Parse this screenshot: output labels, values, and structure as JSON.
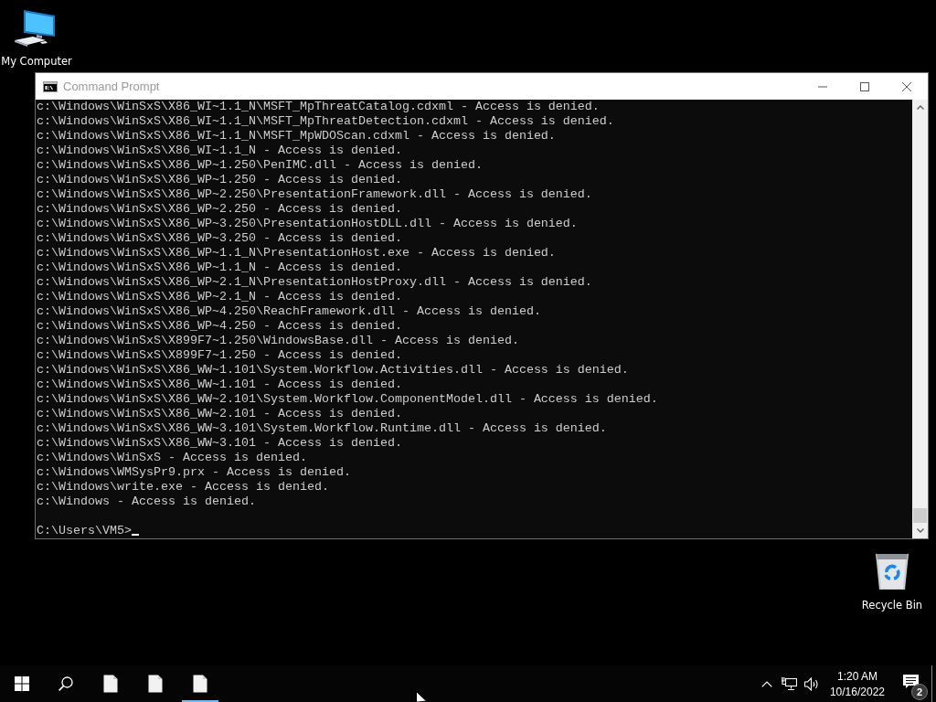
{
  "desktop_icons": [
    {
      "kind": "computer",
      "label": "My Computer"
    },
    {
      "kind": "recycle-bin",
      "label": "Recycle Bin"
    }
  ],
  "window": {
    "title": "Command Prompt",
    "lines": [
      "c:\\Windows\\WinSxS\\X86_WI~1.1_N\\MSFT_MpThreatCatalog.cdxml - Access is denied.",
      "c:\\Windows\\WinSxS\\X86_WI~1.1_N\\MSFT_MpThreatDetection.cdxml - Access is denied.",
      "c:\\Windows\\WinSxS\\X86_WI~1.1_N\\MSFT_MpWDOScan.cdxml - Access is denied.",
      "c:\\Windows\\WinSxS\\X86_WI~1.1_N - Access is denied.",
      "c:\\Windows\\WinSxS\\X86_WP~1.250\\PenIMC.dll - Access is denied.",
      "c:\\Windows\\WinSxS\\X86_WP~1.250 - Access is denied.",
      "c:\\Windows\\WinSxS\\X86_WP~2.250\\PresentationFramework.dll - Access is denied.",
      "c:\\Windows\\WinSxS\\X86_WP~2.250 - Access is denied.",
      "c:\\Windows\\WinSxS\\X86_WP~3.250\\PresentationHostDLL.dll - Access is denied.",
      "c:\\Windows\\WinSxS\\X86_WP~3.250 - Access is denied.",
      "c:\\Windows\\WinSxS\\X86_WP~1.1_N\\PresentationHost.exe - Access is denied.",
      "c:\\Windows\\WinSxS\\X86_WP~1.1_N - Access is denied.",
      "c:\\Windows\\WinSxS\\X86_WP~2.1_N\\PresentationHostProxy.dll - Access is denied.",
      "c:\\Windows\\WinSxS\\X86_WP~2.1_N - Access is denied.",
      "c:\\Windows\\WinSxS\\X86_WP~4.250\\ReachFramework.dll - Access is denied.",
      "c:\\Windows\\WinSxS\\X86_WP~4.250 - Access is denied.",
      "c:\\Windows\\WinSxS\\X899F7~1.250\\WindowsBase.dll - Access is denied.",
      "c:\\Windows\\WinSxS\\X899F7~1.250 - Access is denied.",
      "c:\\Windows\\WinSxS\\X86_WW~1.101\\System.Workflow.Activities.dll - Access is denied.",
      "c:\\Windows\\WinSxS\\X86_WW~1.101 - Access is denied.",
      "c:\\Windows\\WinSxS\\X86_WW~2.101\\System.Workflow.ComponentModel.dll - Access is denied.",
      "c:\\Windows\\WinSxS\\X86_WW~2.101 - Access is denied.",
      "c:\\Windows\\WinSxS\\X86_WW~3.101\\System.Workflow.Runtime.dll - Access is denied.",
      "c:\\Windows\\WinSxS\\X86_WW~3.101 - Access is denied.",
      "c:\\Windows\\WinSxS - Access is denied.",
      "c:\\Windows\\WMSysPr9.prx - Access is denied.",
      "c:\\Windows\\write.exe - Access is denied.",
      "c:\\Windows - Access is denied."
    ],
    "prompt": "C:\\Users\\VM5>"
  },
  "taskbar": {
    "apps": [
      {
        "selected": false
      },
      {
        "selected": false
      },
      {
        "selected": true
      }
    ],
    "clock": {
      "time": "1:20 AM",
      "date": "10/16/2022"
    },
    "notifications": "2"
  }
}
